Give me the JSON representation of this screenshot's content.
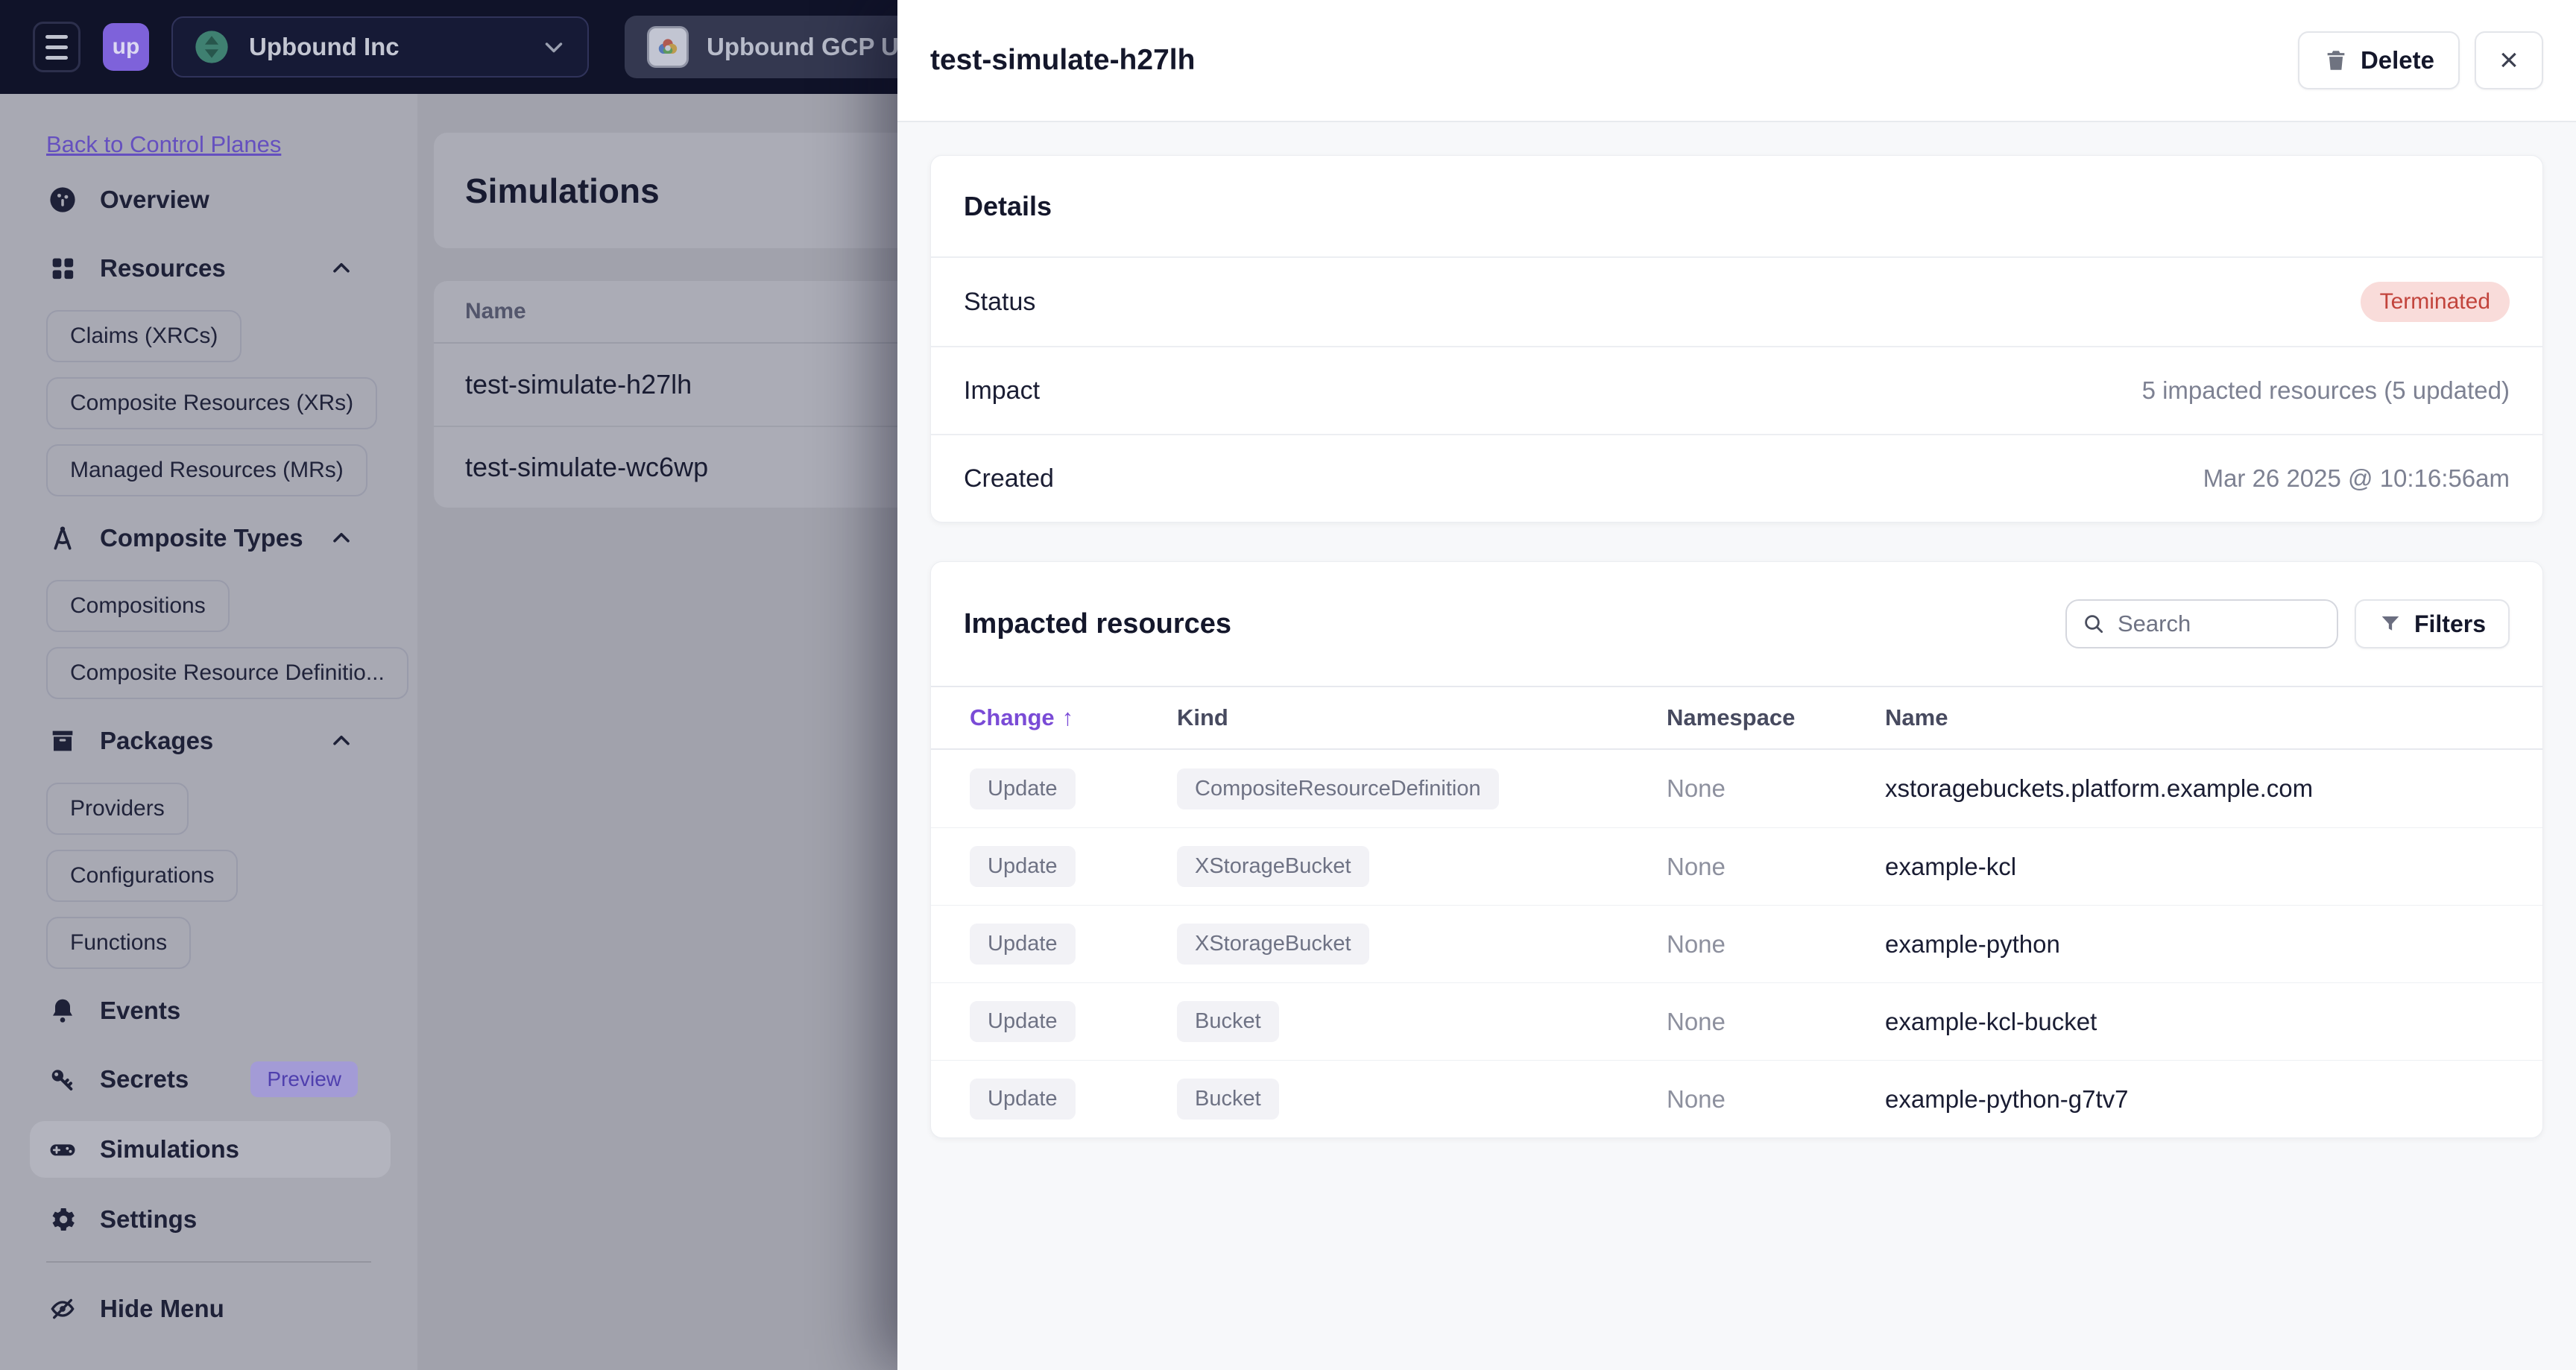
{
  "topbar": {
    "brand": "up",
    "org_name": "Upbound Inc",
    "control_plane_name": "Upbound GCP U"
  },
  "sidebar": {
    "back_link": "Back to Control Planes",
    "overview": "Overview",
    "resources": "Resources",
    "resources_children": [
      "Claims (XRCs)",
      "Composite Resources (XRs)",
      "Managed Resources (MRs)"
    ],
    "composite_types": "Composite Types",
    "composite_types_children": [
      "Compositions",
      "Composite Resource Definitio..."
    ],
    "packages": "Packages",
    "packages_children": [
      "Providers",
      "Configurations",
      "Functions"
    ],
    "events": "Events",
    "secrets": "Secrets",
    "secrets_badge": "Preview",
    "simulations": "Simulations",
    "settings": "Settings",
    "hide_menu": "Hide Menu"
  },
  "main": {
    "page_title": "Simulations",
    "list": {
      "name_header": "Name",
      "rows": [
        "test-simulate-h27lh",
        "test-simulate-wc6wp"
      ]
    }
  },
  "drawer": {
    "title": "test-simulate-h27lh",
    "delete_label": "Delete",
    "close_glyph": "×",
    "details": {
      "header": "Details",
      "status_label": "Status",
      "status_value": "Terminated",
      "impact_label": "Impact",
      "impact_value": "5 impacted resources (5 updated)",
      "created_label": "Created",
      "created_value": "Mar 26 2025 @ 10:16:56am"
    },
    "impacted": {
      "header": "Impacted resources",
      "search_placeholder": "Search",
      "filters_label": "Filters",
      "sort_arrow": "↑",
      "columns": {
        "change": "Change",
        "kind": "Kind",
        "namespace": "Namespace",
        "name": "Name"
      },
      "rows": [
        {
          "change": "Update",
          "kind": "CompositeResourceDefinition",
          "namespace": "None",
          "name": "xstoragebuckets.platform.example.com"
        },
        {
          "change": "Update",
          "kind": "XStorageBucket",
          "namespace": "None",
          "name": "example-kcl"
        },
        {
          "change": "Update",
          "kind": "XStorageBucket",
          "namespace": "None",
          "name": "example-python"
        },
        {
          "change": "Update",
          "kind": "Bucket",
          "namespace": "None",
          "name": "example-kcl-bucket"
        },
        {
          "change": "Update",
          "kind": "Bucket",
          "namespace": "None",
          "name": "example-python-g7tv7"
        }
      ]
    }
  },
  "colors": {
    "topbar_bg": "#101329",
    "brand_purple": "#7e62da",
    "accent_purple": "#7a4bd6",
    "link_purple": "#6550bf",
    "terminated_bg": "#f9dcda",
    "terminated_text": "#c2443c",
    "drawer_bg": "#f7f8fa",
    "panel_bg": "#ffffff",
    "text_dark": "#14172b",
    "text_gray": "#7d8192"
  }
}
